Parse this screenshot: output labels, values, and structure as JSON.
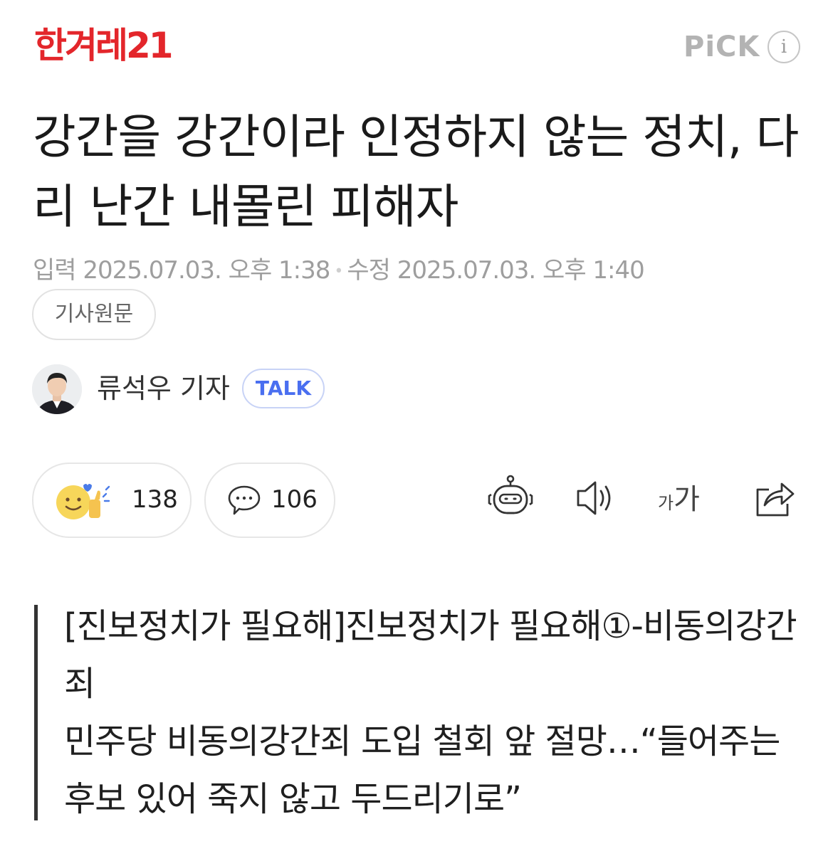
{
  "header": {
    "logo_text": "한겨레21",
    "pick_label": "PiCK",
    "info_icon_label": "i"
  },
  "article": {
    "title": "강간을 강간이라 인정하지 않는 정치, 다리 난간 내몰린 피해자",
    "input_label": "입력",
    "input_date": "2025.07.03. 오후 1:38",
    "modified_label": "수정",
    "modified_date": "2025.07.03. 오후 1:40",
    "original_button": "기사원문"
  },
  "reporter": {
    "name": "류석우 기자",
    "talk_button": "TALK"
  },
  "reactions": {
    "reaction_count": "138",
    "comment_count": "106"
  },
  "toolbar": {
    "font_small": "가",
    "font_big": "가",
    "icons": [
      "robot-summary-icon",
      "speaker-icon",
      "font-size-icon",
      "share-icon"
    ]
  },
  "quote": {
    "line1": "[진보정치가 필요해]진보정치가 필요해①-비동의강간죄",
    "line2": "민주당 비동의강간죄 도입 철회 앞 절망…“들어주는 후보 있어 죽지 않고 두드리기로”"
  },
  "colors": {
    "brand_red": "#e3262b",
    "talk_blue": "#4a6ff0",
    "meta_gray": "#9e9e9e"
  }
}
